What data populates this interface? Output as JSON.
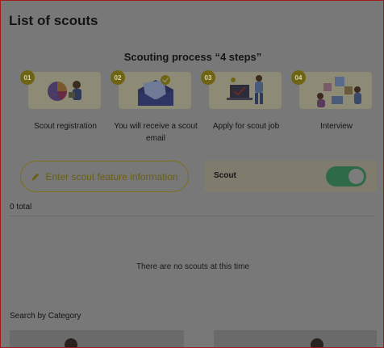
{
  "page": {
    "title": "List of scouts"
  },
  "process": {
    "title": "Scouting process “4 steps”",
    "steps": [
      {
        "number": "01",
        "label": "Scout registration",
        "icon": "chart-person-illustration"
      },
      {
        "number": "02",
        "label": "You will receive a scout email",
        "icon": "email-illustration"
      },
      {
        "number": "03",
        "label": "Apply for scout job",
        "icon": "laptop-person-illustration"
      },
      {
        "number": "04",
        "label": "Interview",
        "icon": "puzzle-people-illustration"
      }
    ]
  },
  "actions": {
    "enter_feature_label": "Enter scout feature information"
  },
  "scout_toggle": {
    "label": "Scout",
    "on": true
  },
  "list": {
    "total": "0 total",
    "empty_message": "There are no scouts at this time"
  },
  "search": {
    "category_label": "Search by Category"
  },
  "colors": {
    "accent": "#6f6414",
    "toggle_on": "#2f6a46",
    "overlay": "#787878"
  }
}
